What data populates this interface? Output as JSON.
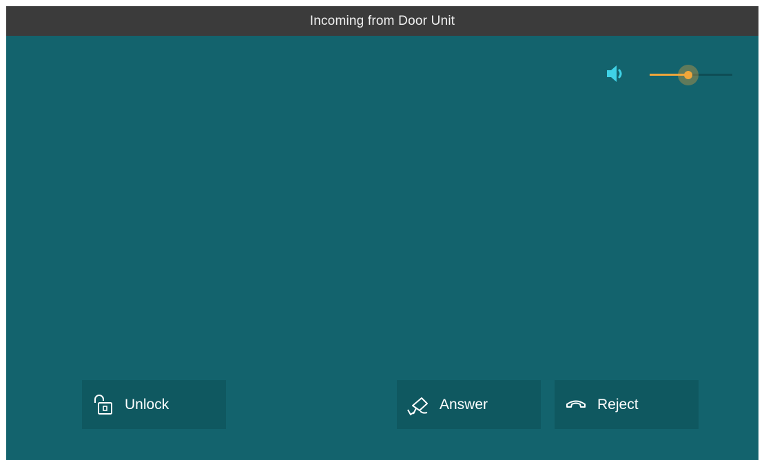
{
  "header": {
    "title": "Incoming from Door Unit"
  },
  "volume": {
    "icon": "speaker-icon",
    "level_fraction": 0.47
  },
  "actions": {
    "unlock": {
      "label": "Unlock",
      "icon": "unlock-icon"
    },
    "answer": {
      "label": "Answer",
      "icon": "camera-icon"
    },
    "reject": {
      "label": "Reject",
      "icon": "hang-up-icon"
    }
  },
  "colors": {
    "background": "#13636d",
    "titlebar": "#3b3b3b",
    "button": "#0f5860",
    "accent": "#f1a63a",
    "speaker": "#3fd2e6"
  }
}
